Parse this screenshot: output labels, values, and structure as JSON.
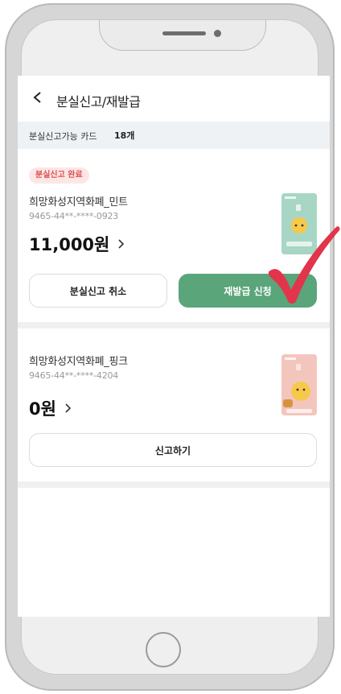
{
  "header": {
    "title": "분실신고/재발급"
  },
  "summary": {
    "label": "분실신고가능 카드",
    "count": "18개"
  },
  "cards": [
    {
      "badge": "분실신고 완료",
      "name": "희망화성지역화폐_민트",
      "number": "9465-44**-****-0923",
      "balance": "11,000원",
      "buttons": {
        "left": "분실신고 취소",
        "right": "재발급 신청"
      },
      "color": "#a8d6c4"
    },
    {
      "name": "희망화성지역화폐_핑크",
      "number": "9465-44**-****-4204",
      "balance": "0원",
      "buttons": {
        "single": "신고하기"
      },
      "color": "#f3c6bd"
    }
  ],
  "colors": {
    "accent_green": "#5aa57a",
    "badge_red": "#e05050",
    "check_red": "#e2344a"
  }
}
